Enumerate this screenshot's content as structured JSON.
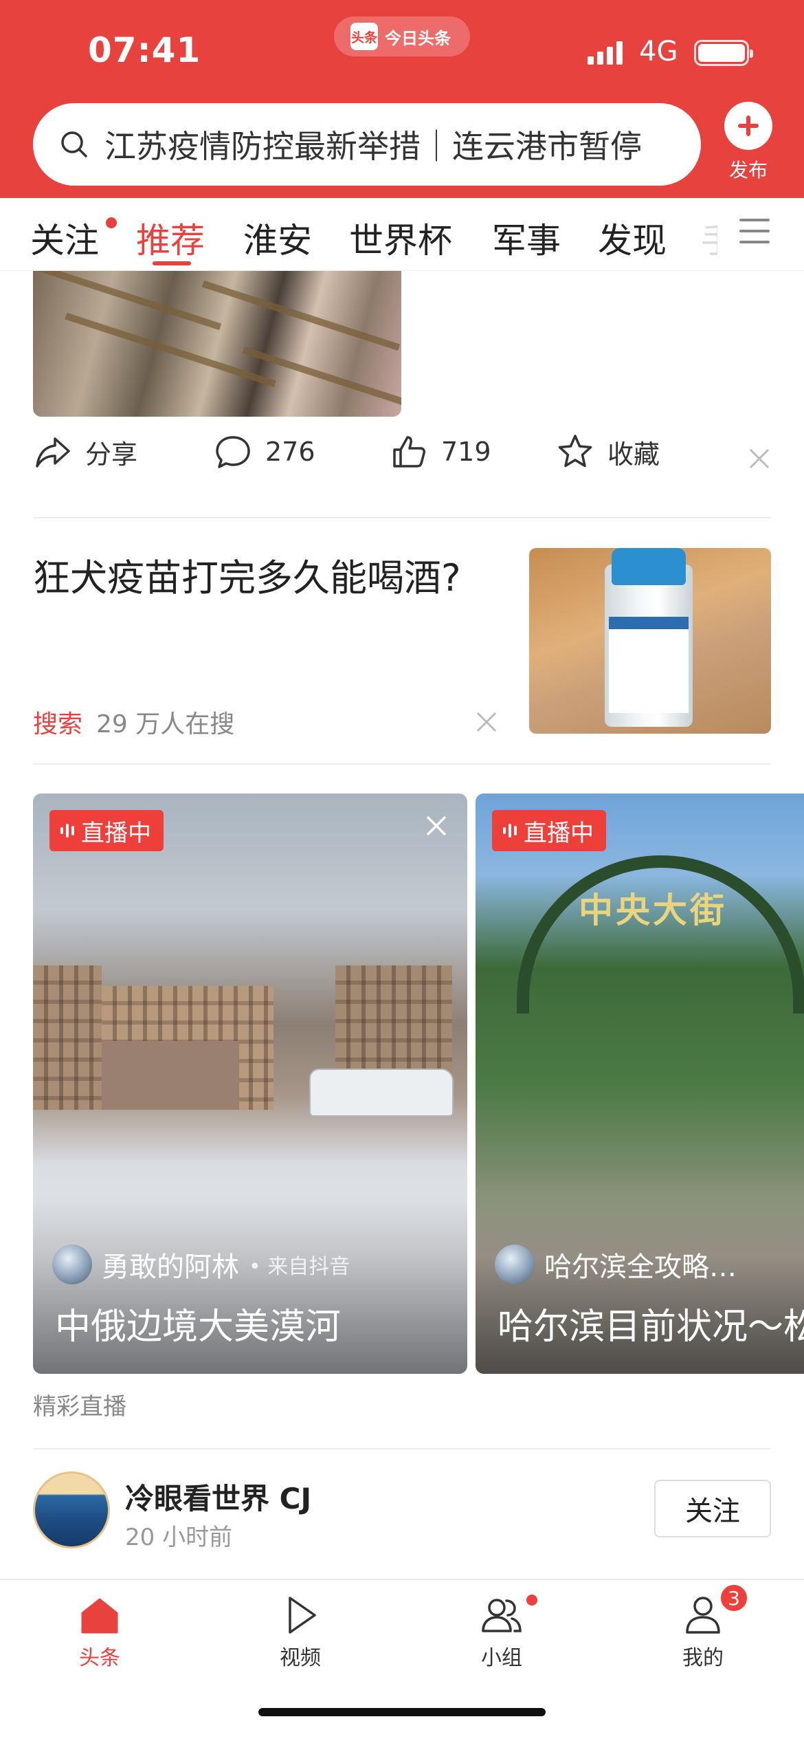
{
  "status_bar": {
    "time": "07:41",
    "app_pill": "今日头条",
    "app_logo": "头条",
    "network": "4G"
  },
  "search": {
    "text": "江苏疫情防控最新举措｜连云港市暂停"
  },
  "publish": {
    "label": "发布"
  },
  "tabs": [
    {
      "label": "关注",
      "has_dot": true
    },
    {
      "label": "推荐",
      "active": true
    },
    {
      "label": "淮安"
    },
    {
      "label": "世界杯"
    },
    {
      "label": "军事"
    },
    {
      "label": "发现"
    }
  ],
  "tab_partial": "手",
  "actions": {
    "share": "分享",
    "comments": "276",
    "likes": "719",
    "favorite": "收藏"
  },
  "search_card": {
    "title": "狂犬疫苗打完多久能喝酒?",
    "tag": "搜索",
    "count": "29 万人在搜"
  },
  "live_cards": [
    {
      "badge": "直播中",
      "author": "勇敢的阿林",
      "source": "• 来自抖音",
      "title": "中俄边境大美漠河"
    },
    {
      "badge": "直播中",
      "author": "哈尔滨全攻略…",
      "title": "哈尔滨目前状况～松",
      "sign": "中央大街"
    }
  ],
  "live_caption": "精彩直播",
  "author_row": {
    "name": "冷眼看世界 CJ",
    "time": "20 小时前",
    "follow": "关注"
  },
  "bottom_nav": [
    {
      "label": "头条",
      "icon": "home-icon",
      "active": true
    },
    {
      "label": "视频",
      "icon": "play-icon"
    },
    {
      "label": "小组",
      "icon": "group-icon",
      "dot": true
    },
    {
      "label": "我的",
      "icon": "profile-icon",
      "badge": "3"
    }
  ],
  "colors": {
    "brand": "#e8423f",
    "live_badge": "#ef3f3a",
    "muted": "#888888"
  }
}
